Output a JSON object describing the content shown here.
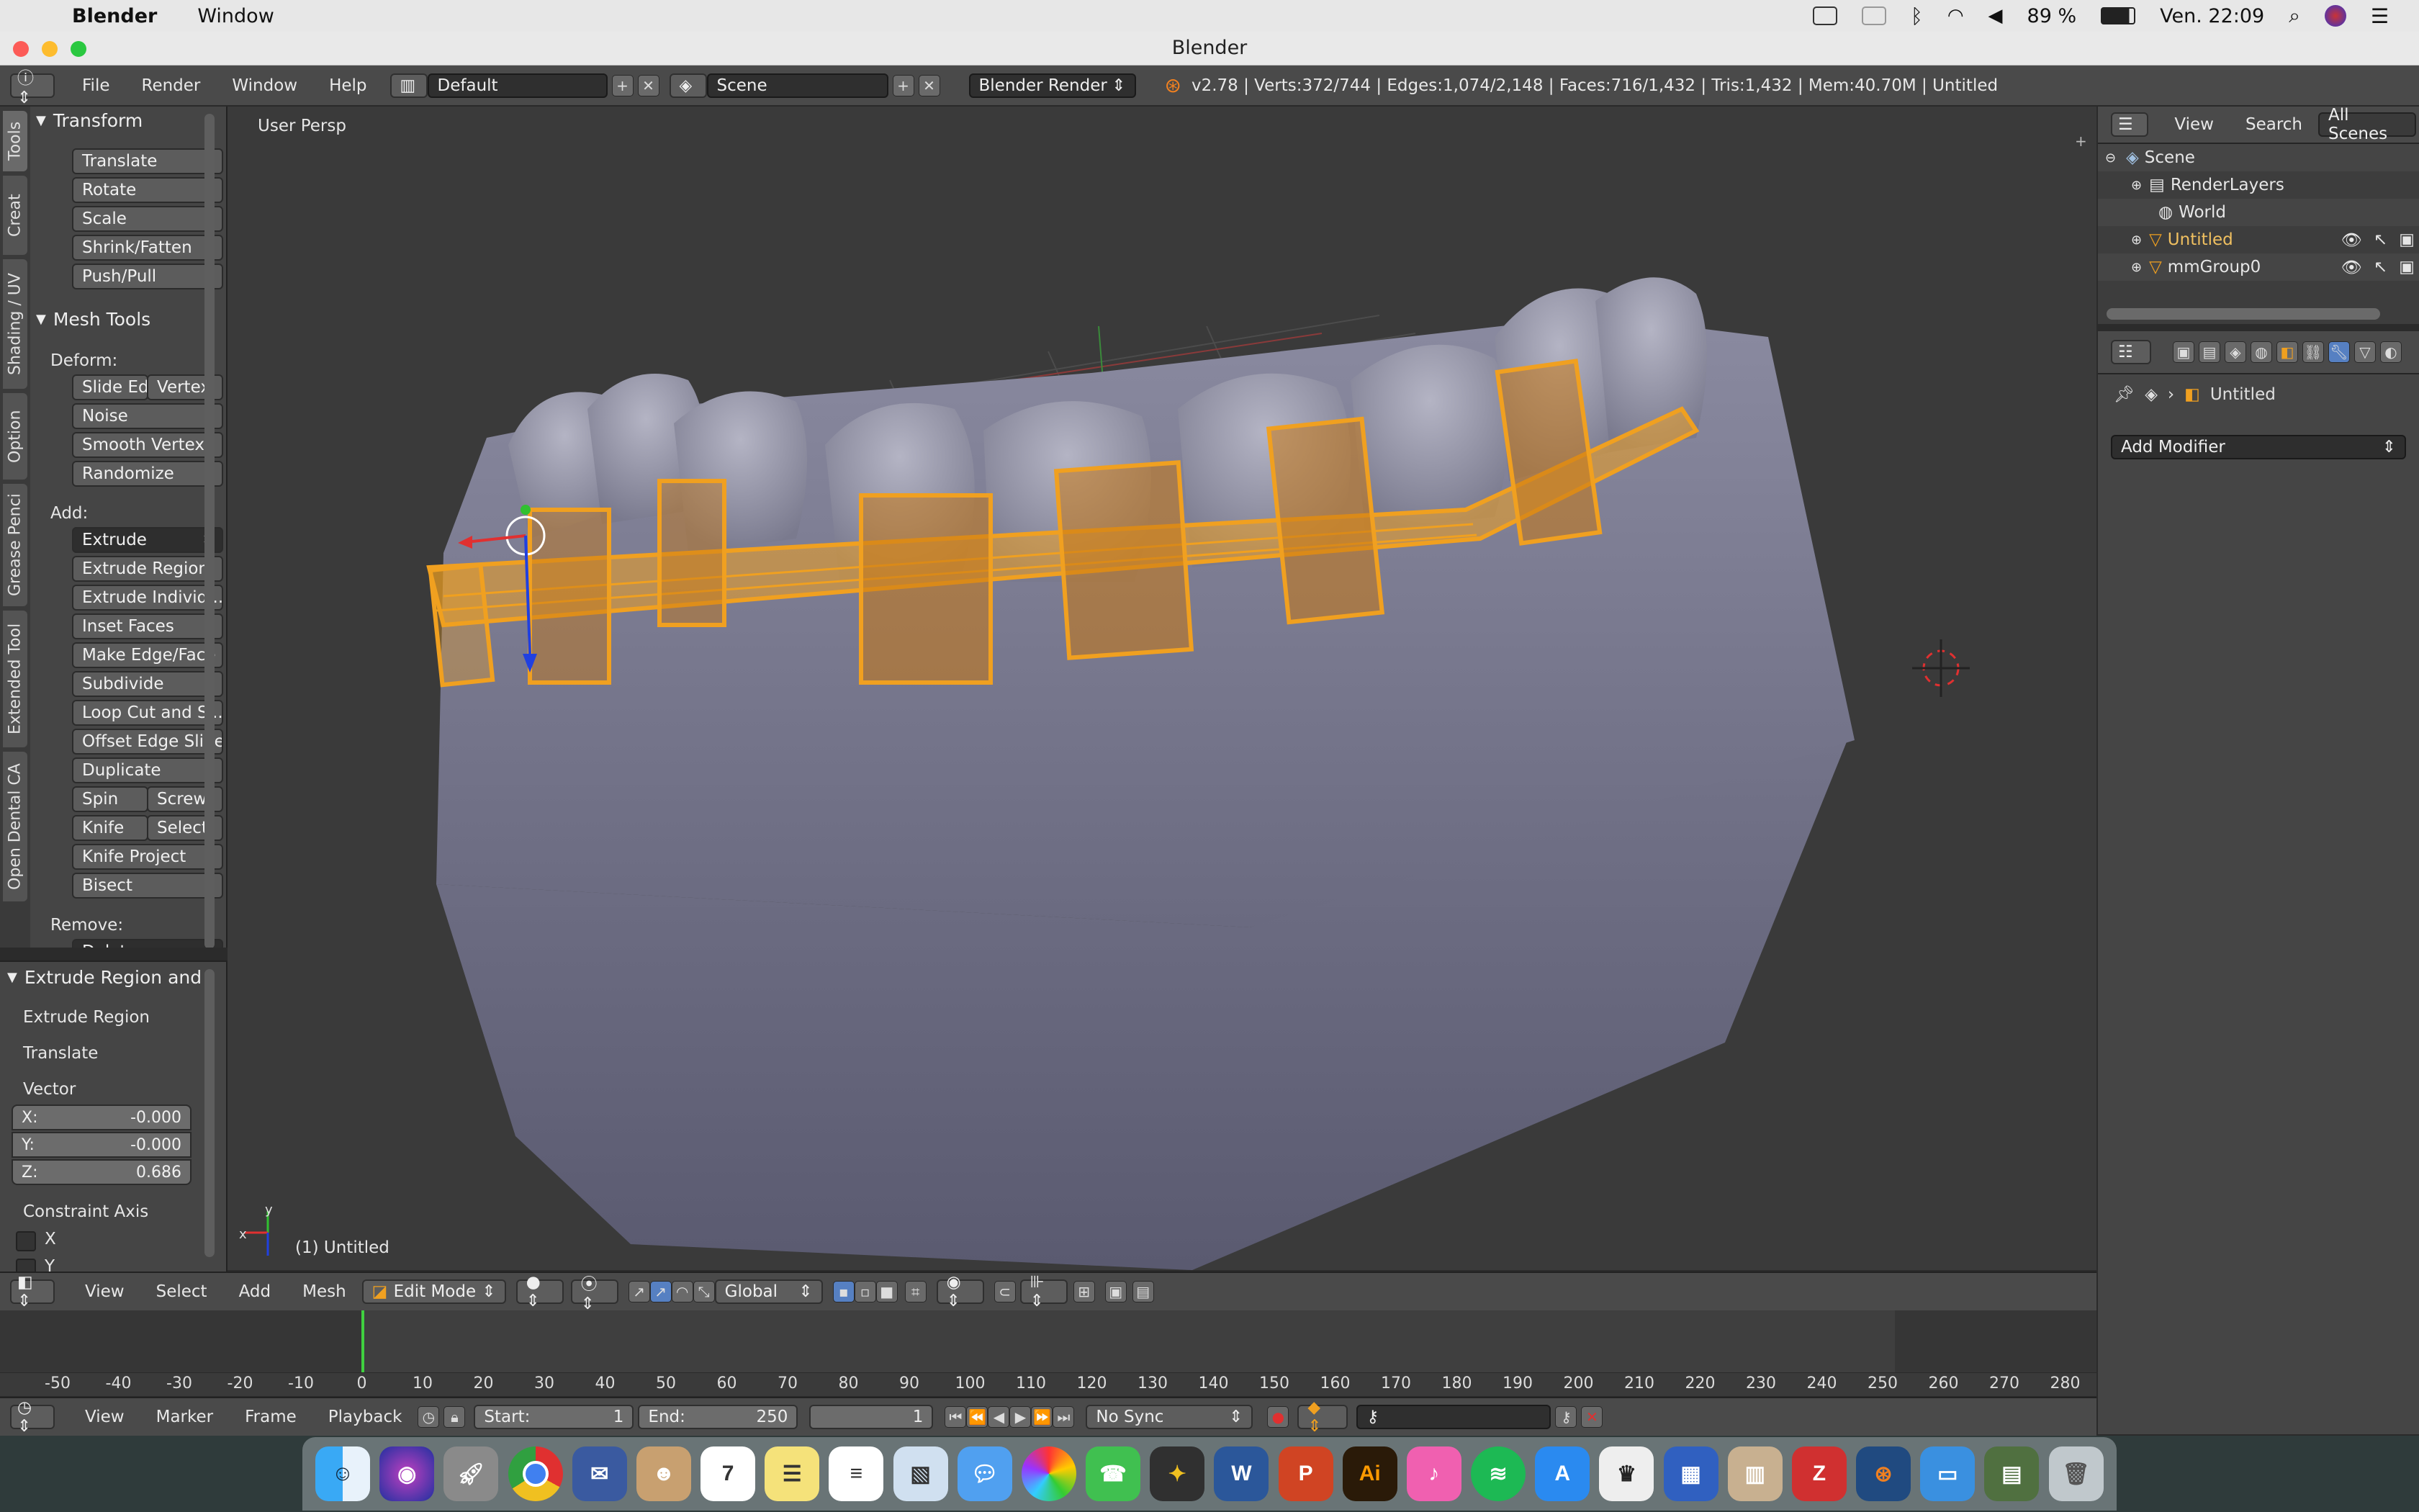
{
  "mac_menu": {
    "app_name": "Blender",
    "window_menu": "Window",
    "battery": "89 %",
    "clock": "Ven. 22:09"
  },
  "window": {
    "title": "Blender"
  },
  "header": {
    "menus": [
      "File",
      "Render",
      "Window",
      "Help"
    ],
    "layout": "Default",
    "scene": "Scene",
    "engine": "Blender Render",
    "stats": "v2.78 | Verts:372/744 | Edges:1,074/2,148 | Faces:716/1,432 | Tris:1,432 | Mem:40.70M | Untitled"
  },
  "tabs": [
    "Tools",
    "Creat",
    "Shading / UV",
    "Option",
    "Grease Penci",
    "Extended Tool",
    "Open Dental CA"
  ],
  "transform": {
    "title": "Transform",
    "buttons": [
      "Translate",
      "Rotate",
      "Scale",
      "Shrink/Fatten",
      "Push/Pull"
    ]
  },
  "mesh_tools": {
    "title": "Mesh Tools",
    "deform_label": "Deform:",
    "slide_edge": "Slide Ed",
    "vertex": "Vertex",
    "noise": "Noise",
    "smooth_vertex": "Smooth Vertex",
    "randomize": "Randomize",
    "add_label": "Add:",
    "extrude": "Extrude",
    "extrude_region": "Extrude Region",
    "extrude_individual": "Extrude Individ...",
    "inset_faces": "Inset Faces",
    "make_edge_face": "Make Edge/Face",
    "subdivide": "Subdivide",
    "loop_cut": "Loop Cut and Sl...",
    "offset_edge_slide": "Offset Edge Slide",
    "duplicate": "Duplicate",
    "spin": "Spin",
    "screw": "Screw",
    "knife": "Knife",
    "select": "Select",
    "knife_project": "Knife Project",
    "bisect": "Bisect",
    "remove_label": "Remove:",
    "delete": "Delete"
  },
  "operator": {
    "title": "Extrude Region and",
    "extrude_region": "Extrude Region",
    "translate": "Translate",
    "vector_label": "Vector",
    "x_label": "X:",
    "x_value": "-0.000",
    "y_label": "Y:",
    "y_value": "-0.000",
    "z_label": "Z:",
    "z_value": "0.686",
    "constraint_label": "Constraint Axis",
    "cx": "X",
    "cy": "Y"
  },
  "viewport": {
    "view_name": "User Persp",
    "object_label": "(1) Untitled",
    "axis_x": "x",
    "axis_y": "y"
  },
  "view_header": {
    "menus": [
      "View",
      "Select",
      "Add",
      "Mesh"
    ],
    "mode": "Edit Mode",
    "orientation": "Global"
  },
  "timeline": {
    "ticks": [
      "-50",
      "-40",
      "-30",
      "-20",
      "-10",
      "0",
      "10",
      "20",
      "30",
      "40",
      "50",
      "60",
      "70",
      "80",
      "90",
      "100",
      "110",
      "120",
      "130",
      "140",
      "150",
      "160",
      "170",
      "180",
      "190",
      "200",
      "210",
      "220",
      "230",
      "240",
      "250",
      "260",
      "270",
      "280"
    ],
    "menus": [
      "View",
      "Marker",
      "Frame",
      "Playback"
    ],
    "start_label": "Start:",
    "start_value": "1",
    "end_label": "End:",
    "end_value": "250",
    "current": "1",
    "sync": "No Sync"
  },
  "outliner": {
    "menus": [
      "View",
      "Search"
    ],
    "filter": "All Scenes",
    "rows": [
      "Scene",
      "RenderLayers",
      "World",
      "Untitled",
      "mmGroup0"
    ]
  },
  "properties": {
    "object": "Untitled",
    "add_modifier": "Add Modifier"
  },
  "colors": {
    "accent_orange": "#f0a020",
    "selection_blue": "#5680c2",
    "panel_bg": "#454545"
  }
}
